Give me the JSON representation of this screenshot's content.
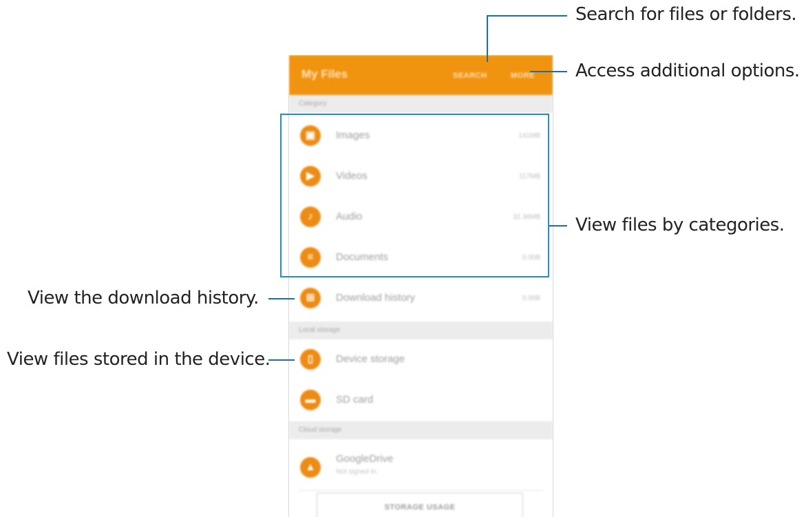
{
  "app": {
    "title": "My Files",
    "actions": {
      "search": "SEARCH",
      "more": "MORE"
    }
  },
  "sections": {
    "category": "Category",
    "local_storage": "Local storage",
    "cloud_storage": "Cloud storage"
  },
  "categories": [
    {
      "label": "Images",
      "size": "141MB",
      "icon": "image-icon",
      "glyph": "▣"
    },
    {
      "label": "Videos",
      "size": "117MB",
      "icon": "video-icon",
      "glyph": "▶"
    },
    {
      "label": "Audio",
      "size": "32.36MB",
      "icon": "music-note-icon",
      "glyph": "♪"
    },
    {
      "label": "Documents",
      "size": "0.00B",
      "icon": "document-icon",
      "glyph": "≡"
    }
  ],
  "download_history": {
    "label": "Download history",
    "size": "0.00B",
    "icon": "download-icon",
    "glyph": "⊞"
  },
  "local": [
    {
      "label": "Device storage",
      "icon": "phone-icon",
      "glyph": "▯"
    },
    {
      "label": "SD card",
      "icon": "sd-card-icon",
      "glyph": "▬"
    }
  ],
  "cloud": {
    "label": "GoogleDrive",
    "sub": "Not signed in.",
    "icon": "google-drive-icon",
    "glyph": "▲"
  },
  "storage_usage_button": "STORAGE USAGE",
  "callouts": {
    "search": "Search for files or folders.",
    "more": "Access additional options.",
    "categories": "View files by categories.",
    "download": "View the download history.",
    "device": "View files stored in the device."
  },
  "colors": {
    "accent": "#f0930f",
    "callout_line": "#1b6fa8",
    "highlight": "#1f8fd0"
  }
}
